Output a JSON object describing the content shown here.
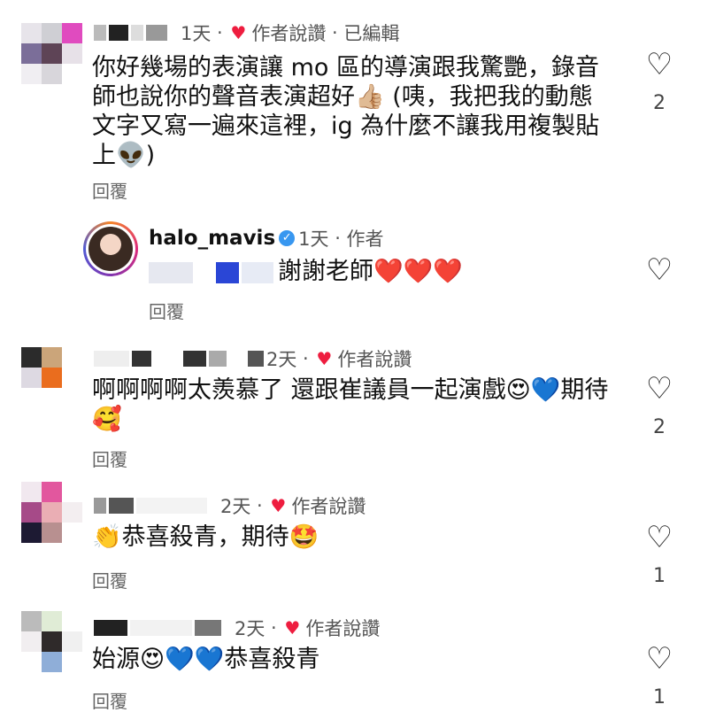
{
  "icons": {
    "like": "heart-outline-icon",
    "author_liked": "red-heart-icon",
    "verified": "verified-badge-icon"
  },
  "colors": {
    "liked_heart": "#ee1d3f",
    "verified": "#3897f0"
  },
  "comments": [
    {
      "time": "1天",
      "liked_by_author": "作者說讚",
      "edited": "已編輯",
      "text": "你好幾場的表演讓 mo 區的導演跟我驚艷，錄音師也說你的聲音表演超好👍🏼 (咦，我把我的動態文字又寫一遍來這裡，ig 為什麼不讓我用複製貼上👽)",
      "reply": "回覆",
      "likes": "2",
      "reply_thread": {
        "username": "halo_mavis",
        "time": "1天",
        "author_tag": "作者",
        "text": "謝謝老師❤️❤️❤️",
        "reply": "回覆"
      }
    },
    {
      "time": "2天",
      "liked_by_author": "作者說讚",
      "text": "啊啊啊啊太羨慕了 還跟崔議員一起演戲😍💙期待🥰",
      "reply": "回覆",
      "likes": "2"
    },
    {
      "time": "2天",
      "liked_by_author": "作者說讚",
      "text": "👏恭喜殺青，期待🤩",
      "reply": "回覆",
      "likes": "1"
    },
    {
      "time": "2天",
      "liked_by_author": "作者說讚",
      "text": "始源😍💙💙恭喜殺青",
      "reply": "回覆",
      "likes": "1"
    }
  ]
}
